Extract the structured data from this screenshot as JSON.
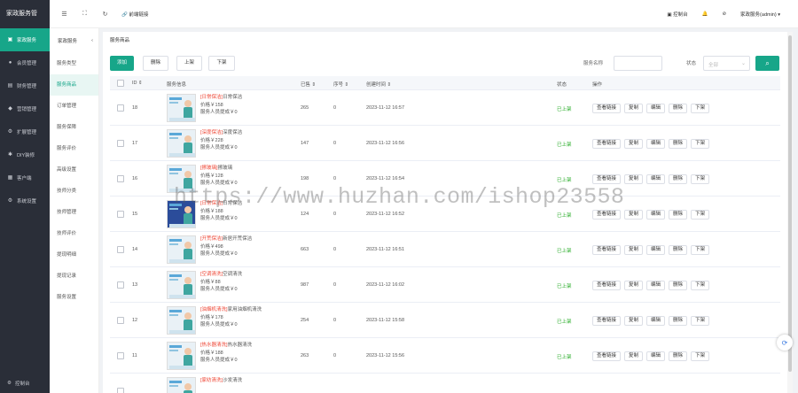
{
  "app": {
    "title": "家政服务管"
  },
  "sidebar": {
    "items": [
      {
        "label": "家政服务",
        "icon": "home-icon",
        "glyph": "▣",
        "active": true
      },
      {
        "label": "会员管理",
        "icon": "user-icon",
        "glyph": "●",
        "active": false
      },
      {
        "label": "财务管理",
        "icon": "wallet-icon",
        "glyph": "▤",
        "active": false
      },
      {
        "label": "营销管理",
        "icon": "megaphone-icon",
        "glyph": "◆",
        "active": false
      },
      {
        "label": "扩展管理",
        "icon": "puzzle-icon",
        "glyph": "⚙",
        "active": false
      },
      {
        "label": "DIY装修",
        "icon": "brush-icon",
        "glyph": "✱",
        "active": false
      },
      {
        "label": "客户端",
        "icon": "grid-icon",
        "glyph": "▦",
        "active": false
      },
      {
        "label": "系统设置",
        "icon": "gear-icon",
        "glyph": "⚙",
        "active": false
      }
    ],
    "bottom_label": "控制台"
  },
  "subnav": {
    "title": "家政服务",
    "items": [
      {
        "label": "服务类型",
        "active": false
      },
      {
        "label": "服务商品",
        "active": true
      },
      {
        "label": "订单管理",
        "active": false
      },
      {
        "label": "服务保障",
        "active": false
      },
      {
        "label": "服务评价",
        "active": false
      },
      {
        "label": "高级设置",
        "active": false
      },
      {
        "label": "技师分类",
        "active": false
      },
      {
        "label": "技师管理",
        "active": false
      },
      {
        "label": "技师评价",
        "active": false
      },
      {
        "label": "提现明细",
        "active": false
      },
      {
        "label": "提现记录",
        "active": false
      },
      {
        "label": "服务设置",
        "active": false
      }
    ]
  },
  "topbar": {
    "front_link": "前端链接",
    "console": "控制台",
    "user": "家政服务(admin)"
  },
  "page": {
    "breadcrumb": "服务商品"
  },
  "toolbar": {
    "add": "添加",
    "delete": "删除",
    "publish": "上架",
    "unpublish": "下架",
    "search_label": "服务名称",
    "status_label": "状态",
    "status_placeholder": "全部"
  },
  "table": {
    "headers": [
      "ID",
      "服务信息",
      "已售",
      "序号",
      "创建时间",
      "状态",
      "操作"
    ],
    "sort_mark": "⇕",
    "price_prefix": "价格￥",
    "commission_prefix": "服务人员提成￥",
    "ops": [
      "查看链接",
      "复制",
      "编辑",
      "删除",
      "下架"
    ],
    "rows": [
      {
        "id": "18",
        "tag": "[日常保洁]",
        "name": "日常保洁",
        "price": "158",
        "commission": "0",
        "sold": "265",
        "seq": "0",
        "created": "2023-11-12 16:57",
        "status": "已上架"
      },
      {
        "id": "17",
        "tag": "[深度保洁]",
        "name": "深度保洁",
        "price": "228",
        "commission": "0",
        "sold": "147",
        "seq": "0",
        "created": "2023-11-12 16:56",
        "status": "已上架"
      },
      {
        "id": "16",
        "tag": "[擦玻璃]",
        "name": "擦玻璃",
        "price": "128",
        "commission": "0",
        "sold": "198",
        "seq": "0",
        "created": "2023-11-12 16:54",
        "status": "已上架"
      },
      {
        "id": "15",
        "tag": "[日常保洁]",
        "name": "日常保洁",
        "price": "188",
        "commission": "0",
        "sold": "124",
        "seq": "0",
        "created": "2023-11-12 16:52",
        "status": "已上架"
      },
      {
        "id": "14",
        "tag": "[开荒保洁]",
        "name": "新居开荒保洁",
        "price": "498",
        "commission": "0",
        "sold": "663",
        "seq": "0",
        "created": "2023-11-12 16:51",
        "status": "已上架"
      },
      {
        "id": "13",
        "tag": "[空调清洗]",
        "name": "空调清洗",
        "price": "88",
        "commission": "0",
        "sold": "987",
        "seq": "0",
        "created": "2023-11-12 16:02",
        "status": "已上架"
      },
      {
        "id": "12",
        "tag": "[油烟机清洗]",
        "name": "家用油烟机清洗",
        "price": "178",
        "commission": "0",
        "sold": "254",
        "seq": "0",
        "created": "2023-11-12 15:58",
        "status": "已上架"
      },
      {
        "id": "11",
        "tag": "[热水器清洗]",
        "name": "热水器清洗",
        "price": "188",
        "commission": "0",
        "sold": "263",
        "seq": "0",
        "created": "2023-11-12 15:56",
        "status": "已上架"
      },
      {
        "id": "",
        "tag": "[家纺清洗]",
        "name": "沙发清洗",
        "price": "",
        "commission": "",
        "sold": "",
        "seq": "",
        "created": "",
        "status": ""
      }
    ]
  },
  "watermark": "https://www.huzhan.com/ishop23558",
  "colors": {
    "accent": "#17a689",
    "sidebar": "#2a2e38",
    "tag": "#ee4433",
    "status": "#22aa22"
  }
}
